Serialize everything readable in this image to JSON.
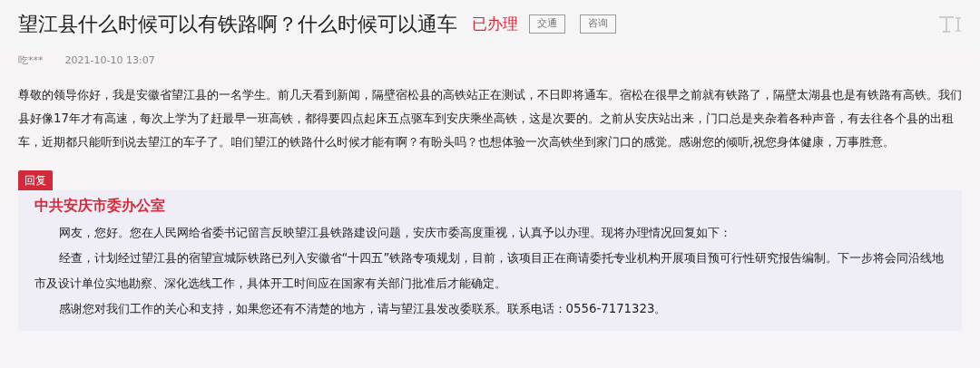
{
  "title": "望江县什么时候可以有铁路啊？什么时候可以通车",
  "status": "已办理",
  "tags": [
    "交通",
    "咨询"
  ],
  "author": "吃***",
  "time": "2021-10-10 13:07",
  "question": "尊敬的领导你好，我是安徽省望江县的一名学生。前几天看到新闻，隔壁宿松县的高铁站正在测试，不日即将通车。宿松在很早之前就有铁路了，隔壁太湖县也是有铁路有高铁。我们县好像17年才有高速，每次上学为了赶最早一班高铁，都得要四点起床五点驱车到安庆乘坐高铁，这是次要的。之前从安庆站出来，门口总是夹杂着各种声音，有去往各个县的出租车，近期都只能听到说去望江的车子了。咱们望江的铁路什么时候才能有啊？有盼头吗？也想体验一次高铁坐到家门口的感觉。感谢您的倾听,祝您身体健康，万事胜意。",
  "reply_label": "回复",
  "reply": {
    "org": "中共安庆市委办公室",
    "paragraphs": [
      "网友，您好。您在人民网给省委书记留言反映望江县铁路建设问题，安庆市委高度重视，认真予以办理。现将办理情况回复如下：",
      "经查，计划经过望江县的宿望宣城际铁路已列入安徽省“十四五”铁路专项规划，目前，该项目正在商请委托专业机构开展项目预可行性研究报告编制。下一步将会同沿线地市及设计单位实地勘察、深化选线工作，具体开工时间应在国家有关部门批准后才能确定。",
      "感谢您对我们工作的关心和支持，如果您还有不清楚的地方，请与望江县发改委联系。联系电话：0556-7171323。"
    ]
  }
}
